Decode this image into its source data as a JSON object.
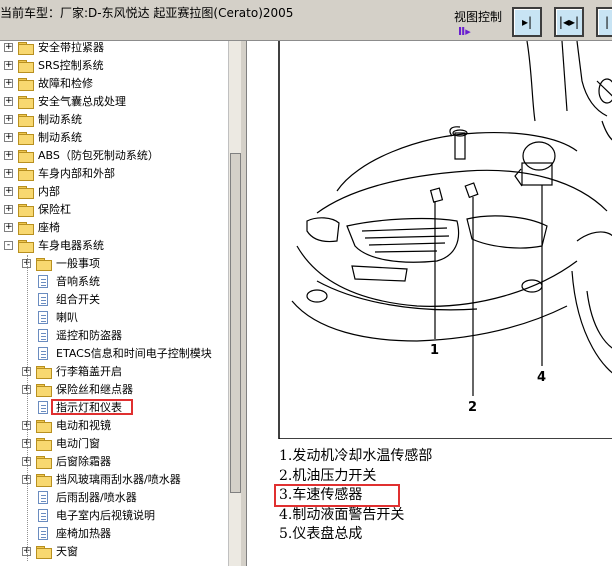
{
  "header": {
    "title": "当前车型：厂家:D-东风悦达 起亚赛拉图(Cerato)2005",
    "view_control_label": "视图控制",
    "view_buttons": [
      "▸|",
      "|◂▸|",
      "|"
    ]
  },
  "tree": {
    "items": [
      {
        "label": "安全带拉紧器",
        "type": "folder",
        "expand": "+",
        "level": 0
      },
      {
        "label": "SRS控制系统",
        "type": "folder",
        "expand": "+",
        "level": 0
      },
      {
        "label": "故障和检修",
        "type": "folder",
        "expand": "+",
        "level": 0
      },
      {
        "label": "安全气囊总成处理",
        "type": "folder",
        "expand": "+",
        "level": 0
      },
      {
        "label": "制动系统",
        "type": "folder",
        "expand": "+",
        "level": 0
      },
      {
        "label": "制动系统",
        "type": "folder",
        "expand": "+",
        "level": 0
      },
      {
        "label": "ABS（防包死制动系统）",
        "type": "folder",
        "expand": "+",
        "level": 0
      },
      {
        "label": "车身内部和外部",
        "type": "folder",
        "expand": "+",
        "level": 0
      },
      {
        "label": "内部",
        "type": "folder",
        "expand": "+",
        "level": 0
      },
      {
        "label": "保险杠",
        "type": "folder",
        "expand": "+",
        "level": 0
      },
      {
        "label": "座椅",
        "type": "folder",
        "expand": "+",
        "level": 0
      },
      {
        "label": "车身电器系统",
        "type": "folder",
        "expand": "-",
        "level": 0
      },
      {
        "label": "一般事项",
        "type": "folder",
        "expand": "+",
        "level": 1
      },
      {
        "label": "音响系统",
        "type": "doc",
        "expand": "",
        "level": 1
      },
      {
        "label": "组合开关",
        "type": "doc",
        "expand": "",
        "level": 1
      },
      {
        "label": "喇叭",
        "type": "doc",
        "expand": "",
        "level": 1
      },
      {
        "label": "遥控和防盗器",
        "type": "doc",
        "expand": "",
        "level": 1
      },
      {
        "label": "ETACS信息和时间电子控制模块",
        "type": "doc",
        "expand": "",
        "level": 1
      },
      {
        "label": "行李箱盖开启",
        "type": "folder",
        "expand": "+",
        "level": 1
      },
      {
        "label": "保险丝和继点器",
        "type": "folder",
        "expand": "+",
        "level": 1
      },
      {
        "label": "指示灯和仪表",
        "type": "doc",
        "expand": "",
        "level": 1,
        "selected": true
      },
      {
        "label": "电动和视镜",
        "type": "folder",
        "expand": "+",
        "level": 1
      },
      {
        "label": "电动门窗",
        "type": "folder",
        "expand": "+",
        "level": 1
      },
      {
        "label": "后窗除霜器",
        "type": "folder",
        "expand": "+",
        "level": 1
      },
      {
        "label": "挡风玻璃雨刮水器/喷水器",
        "type": "folder",
        "expand": "+",
        "level": 1
      },
      {
        "label": "后雨刮器/喷水器",
        "type": "doc",
        "expand": "",
        "level": 1
      },
      {
        "label": "电子室内后视镜说明",
        "type": "doc",
        "expand": "",
        "level": 1
      },
      {
        "label": "座椅加热器",
        "type": "doc",
        "expand": "",
        "level": 1
      },
      {
        "label": "天窗",
        "type": "folder",
        "expand": "+",
        "level": 1
      }
    ]
  },
  "diagram": {
    "callouts": [
      "1",
      "2",
      "4"
    ]
  },
  "legend": [
    "1.发动机冷却水温传感部",
    "2.机油压力开关",
    "3.车速传感器",
    "4.制动液面警告开关",
    "5.仪表盘总成"
  ],
  "highlight_color": "#e03030"
}
